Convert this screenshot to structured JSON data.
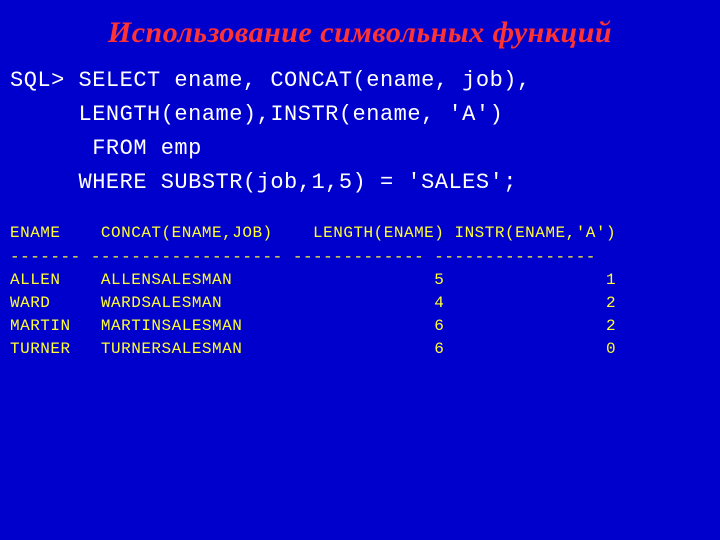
{
  "title": "Использование символьных функций",
  "sql": {
    "l1": "SQL> SELECT ename, CONCAT(ename, job),",
    "l2": "     LENGTH(ename),INSTR(ename, 'A')",
    "l3": "      FROM emp",
    "l4": "     WHERE SUBSTR(job,1,5) = 'SALES';"
  },
  "result": {
    "header": "ENAME    CONCAT(ENAME,JOB)    LENGTH(ENAME) INSTR(ENAME,'A')",
    "sep": "------- ------------------- ------------- ----------------",
    "r1": "ALLEN    ALLENSALESMAN                    5                1",
    "r2": "WARD     WARDSALESMAN                     4                2",
    "r3": "MARTIN   MARTINSALESMAN                   6                2",
    "r4": "TURNER   TURNERSALESMAN                   6                0"
  },
  "chart_data": {
    "type": "table",
    "title": "SQL character functions result",
    "columns": [
      "ENAME",
      "CONCAT(ENAME,JOB)",
      "LENGTH(ENAME)",
      "INSTR(ENAME,'A')"
    ],
    "rows": [
      [
        "ALLEN",
        "ALLENSALESMAN",
        5,
        1
      ],
      [
        "WARD",
        "WARDSALESMAN",
        4,
        2
      ],
      [
        "MARTIN",
        "MARTINSALESMAN",
        6,
        2
      ],
      [
        "TURNER",
        "TURNERSALESMAN",
        6,
        0
      ]
    ]
  }
}
